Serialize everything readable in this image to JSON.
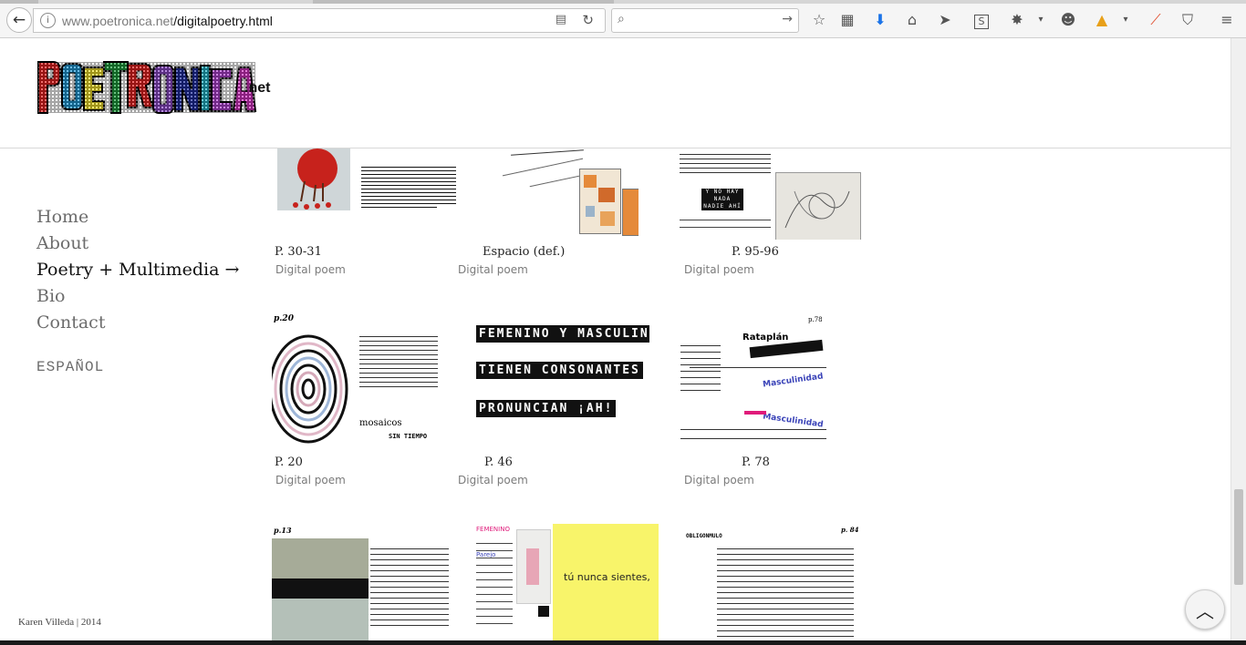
{
  "browser": {
    "url_domain": "www.poetronica.net",
    "url_path": "/digitalpoetry.html",
    "search_placeholder": ""
  },
  "site": {
    "logo_text": "POETRONICA",
    "logo_suffix": ".net",
    "logo_colors": [
      "#e8201e",
      "#1f9ad8",
      "#f6e32a",
      "#1b9c3b",
      "#e8201e",
      "#8c49c9",
      "#1d2b9e",
      "#22b4c8",
      "#b041d1",
      "#d632c3"
    ]
  },
  "nav": {
    "items": [
      {
        "label": "Home"
      },
      {
        "label": "About"
      },
      {
        "label": "Poetry + Multimedia →",
        "active": true
      },
      {
        "label": "Bio"
      },
      {
        "label": "Contact"
      }
    ],
    "language": "ESPAÑOL"
  },
  "footer": {
    "text": "Karen Villeda | 2014"
  },
  "cards": [
    {
      "title": "P. 30-31",
      "category": "Digital poem"
    },
    {
      "title": "Espacio (def.)",
      "category": "Digital poem"
    },
    {
      "title": "P. 95-96",
      "category": "Digital poem"
    },
    {
      "title": "P. 20",
      "category": "Digital poem"
    },
    {
      "title": "P. 46",
      "category": "Digital poem"
    },
    {
      "title": "P. 78",
      "category": "Digital poem"
    }
  ],
  "thumb_text": {
    "nohay": "Y NO HAY NADA NADIE AHÍ",
    "p20": "p.20",
    "sin_tiempo": "SIN TIEMPO",
    "mosaicos": "mosaicos",
    "p46_a": "FEMENINO Y MASCULINO",
    "p46_b": "TIENEN CONSONANTES",
    "p46_c": "PRONUNCIAN ¡AH!",
    "p78": "p.78",
    "rataplan": "Rataplán",
    "masculinidad": "Masculinidad",
    "p13": "p.13",
    "p84": "p. 84",
    "obligonmulo": "OBLIGONMULO",
    "nunca": "tú nunca sientes,",
    "femenino": "FEMENINO",
    "parejo": "Parejo"
  }
}
